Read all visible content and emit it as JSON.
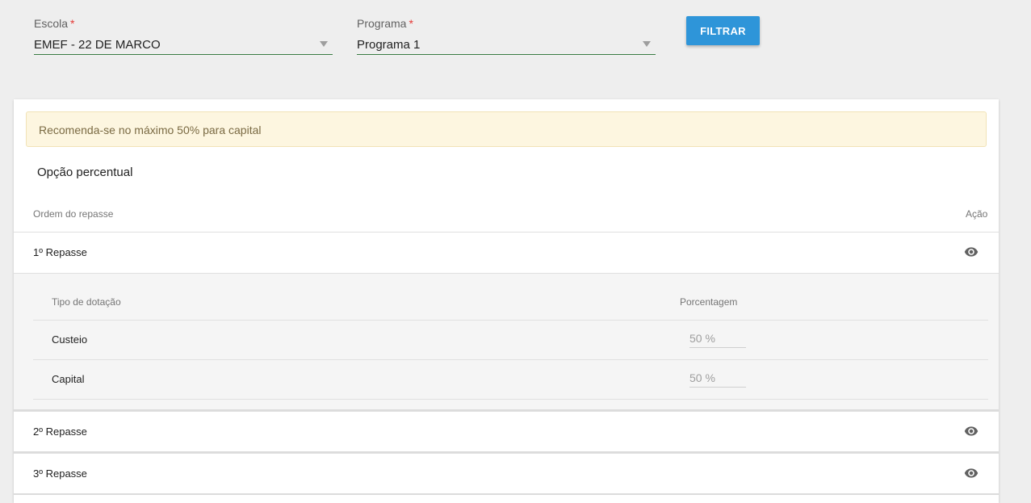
{
  "filters": {
    "escola": {
      "label": "Escola",
      "required_mark": "*",
      "value": "EMEF - 22 DE MARCO"
    },
    "programa": {
      "label": "Programa",
      "required_mark": "*",
      "value": "Programa 1"
    },
    "filter_button": "FILTRAR"
  },
  "card": {
    "alert": "Recomenda-se no máximo 50% para capital",
    "section_title": "Opção percentual",
    "columns": {
      "order": "Ordem do repasse",
      "action": "Ação"
    },
    "repasses": [
      {
        "label": "1º Repasse",
        "action_icon": "eye-icon"
      },
      {
        "label": "2º Repasse",
        "action_icon": "eye-icon"
      },
      {
        "label": "3º Repasse",
        "action_icon": "eye-icon"
      }
    ],
    "detail": {
      "columns": {
        "type": "Tipo de dotação",
        "percent": "Porcentagem"
      },
      "rows": [
        {
          "type": "Custeio",
          "percent": "50 %"
        },
        {
          "type": "Capital",
          "percent": "50 %"
        }
      ]
    }
  },
  "colors": {
    "accent": "#2e95d9",
    "underline": "#3a7d44",
    "alert_bg": "#fdf6e0"
  }
}
